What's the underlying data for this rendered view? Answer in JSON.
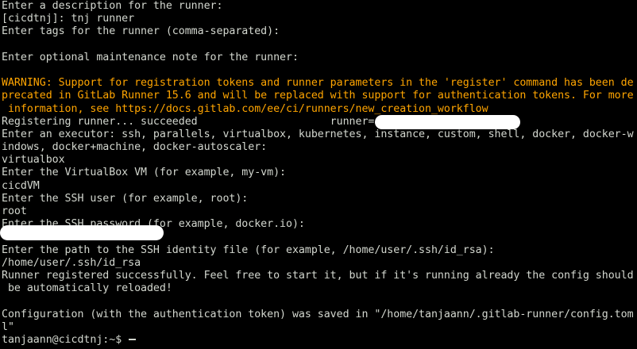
{
  "terminal": {
    "lines": [
      {
        "text": "Enter a description for the runner:"
      },
      {
        "text": "[cicdtnj]: tnj runner"
      },
      {
        "text": "Enter tags for the runner (comma-separated):"
      },
      {
        "text": ""
      },
      {
        "text": "Enter optional maintenance note for the runner:"
      },
      {
        "text": ""
      },
      {
        "text": "WARNING: Support for registration tokens and runner parameters in the 'register' command has been de",
        "style": "warning"
      },
      {
        "text": "precated in GitLab Runner 15.6 and will be replaced with support for authentication tokens. For more",
        "style": "warning"
      },
      {
        "text": " information, see https://docs.gitlab.com/ee/ci/runners/new_creation_workflow",
        "style": "warning"
      },
      {
        "text": "Registering runner... succeeded                     runner=",
        "redacted": true
      },
      {
        "text": "Enter an executor: ssh, parallels, virtualbox, kubernetes, instance, custom, shell, docker, docker-w"
      },
      {
        "text": "indows, docker+machine, docker-autoscaler:"
      },
      {
        "text": "virtualbox"
      },
      {
        "text": "Enter the VirtualBox VM (for example, my-vm):"
      },
      {
        "text": "cicdVM"
      },
      {
        "text": "Enter the SSH user (for example, root):"
      },
      {
        "text": "root"
      },
      {
        "text": "Enter the SSH password (for example, docker.io):"
      },
      {
        "text": ""
      },
      {
        "text": "Enter the path to the SSH identity file (for example, /home/user/.ssh/id_rsa):"
      },
      {
        "text": "/home/user/.ssh/id_rsa"
      },
      {
        "text": "Runner registered successfully. Feel free to start it, but if it's running already the config should"
      },
      {
        "text": " be automatically reloaded!"
      },
      {
        "text": ""
      },
      {
        "text": "Configuration (with the authentication token) was saved in \"/home/tanjaann/.gitlab-runner/config.tom"
      },
      {
        "text": "l\""
      }
    ],
    "prompt": "tanjaann@cicdtnj:~$ ",
    "colors": {
      "background": "#000000",
      "foreground": "#d3d7cf",
      "warning": "#ffa500",
      "redaction": "#ffffff"
    }
  }
}
